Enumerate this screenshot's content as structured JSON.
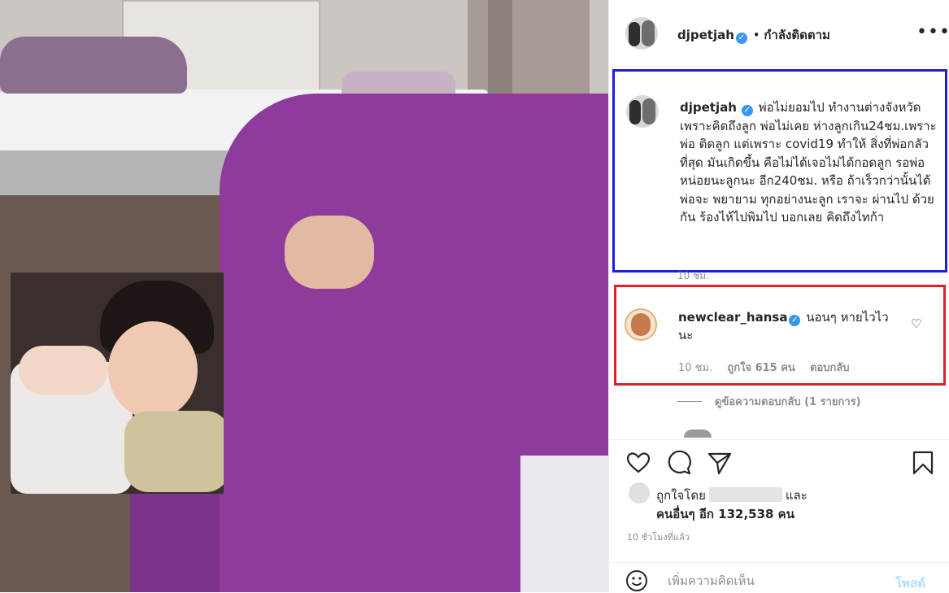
{
  "colors": {
    "verified": "#3897f0",
    "caption_highlight": "#1f1fd6",
    "comment_highlight": "#e0202a",
    "post_button": "#b2dffc",
    "muted_text": "#8e8e8e"
  },
  "header": {
    "username": "djpetjah",
    "separator": "•",
    "follow_status": "กำลังติดตาม",
    "more_icon": "more-horizontal-icon",
    "more_glyph": "•••"
  },
  "caption": {
    "username": "djpetjah",
    "text": "พ่อไม่ยอมไป ทำงานต่างจังหวัด เพราะคิดถึงลูก พ่อไม่เคย ห่างลูกเกิน24ชม.เพราะพ่อ ติดลูก แต่เพราะ covid19 ทำให้ สิ่งที่พ่อกลัวที่สุด มันเกิดขึ้น คือไม่ได้เจอไม่ได้กอดลูก รอพ่อหน่อยนะลูกนะ อีก240ชม. หรือ ถ้าเร็วกว่านั้นได้ พ่อจะ พยายาม ทุกอย่างนะลูก เราจะ ผ่านไป ด้วยกัน ร้องไห้ไปพิมไป บอกเลย คิดถึงไทก้า",
    "time": "10 ชม."
  },
  "comment": {
    "username": "newclear_hansa",
    "text": "นอนๆ หายไวไวนะ",
    "time": "10 ชม.",
    "likes": "ถูกใจ 615 คน",
    "reply": "ตอบกลับ",
    "view_replies": "ดูข้อความตอบกลับ (1 รายการ)"
  },
  "actions": {
    "like_icon": "heart-icon",
    "comment_icon": "comment-icon",
    "share_icon": "paper-plane-icon",
    "save_icon": "bookmark-icon"
  },
  "likes": {
    "liked_by_prefix": "ถูกใจโดย",
    "and": "และ",
    "others": "คนอื่นๆ อีก 132,538 คน"
  },
  "post_time": "10 ชั่วโมงที่แล้ว",
  "add_comment": {
    "placeholder": "เพิ่มความคิดเห็น",
    "post_label": "โพสต์"
  }
}
